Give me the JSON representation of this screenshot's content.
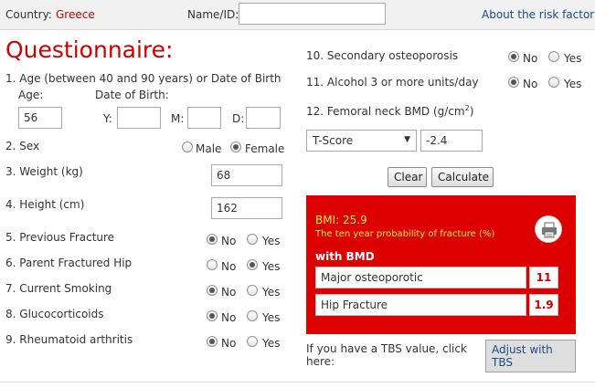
{
  "header": {
    "country_label": "Country:",
    "country_value": "Greece",
    "name_label": "Name/ID:",
    "name_value": "",
    "about_link": "About the risk factors"
  },
  "title": "Questionnaire:",
  "q1": {
    "label": "1. Age (between 40 and 90 years) or Date of Birth",
    "age_label": "Age:",
    "dob_label": "Date of Birth:",
    "age_value": "56",
    "y_label": "Y:",
    "m_label": "M:",
    "d_label": "D:",
    "y_value": "",
    "m_value": "",
    "d_value": ""
  },
  "q2": {
    "label": "2. Sex",
    "male": "Male",
    "female": "Female",
    "selected": "female"
  },
  "q3": {
    "label": "3. Weight (kg)",
    "value": "68"
  },
  "q4": {
    "label": "4. Height (cm)",
    "value": "162"
  },
  "yn": {
    "no": "No",
    "yes": "Yes"
  },
  "questions_yn": [
    {
      "label": "5. Previous Fracture",
      "selected": "no"
    },
    {
      "label": "6. Parent Fractured Hip",
      "selected": "yes"
    },
    {
      "label": "7. Current Smoking",
      "selected": "no"
    },
    {
      "label": "8. Glucocorticoids",
      "selected": "no"
    },
    {
      "label": "9. Rheumatoid arthritis",
      "selected": "no"
    },
    {
      "label": "10. Secondary osteoporosis",
      "selected": "no"
    },
    {
      "label": "11. Alcohol 3 or more units/day",
      "selected": "no"
    }
  ],
  "q12": {
    "label": "12. Femoral neck BMD (g/cm",
    "sup": "2",
    "close": ")",
    "select_value": "T-Score",
    "bmd_value": "-2.4"
  },
  "buttons": {
    "clear": "Clear",
    "calculate": "Calculate"
  },
  "result": {
    "bmi": "BMI: 25.9",
    "prob_label": "The ten year probability of fracture (%)",
    "with_bmd": "with BMD",
    "rows": [
      {
        "label": "Major osteoporotic",
        "value": "11"
      },
      {
        "label": "Hip Fracture",
        "value": "1.9"
      }
    ]
  },
  "tbs": {
    "text": "If you have a TBS value, click here:",
    "button": "Adjust with TBS"
  },
  "colors": {
    "accent": "#cc0000",
    "panel": "#dd0000",
    "highlight": "#ffee33",
    "link": "#1a4a8a"
  }
}
